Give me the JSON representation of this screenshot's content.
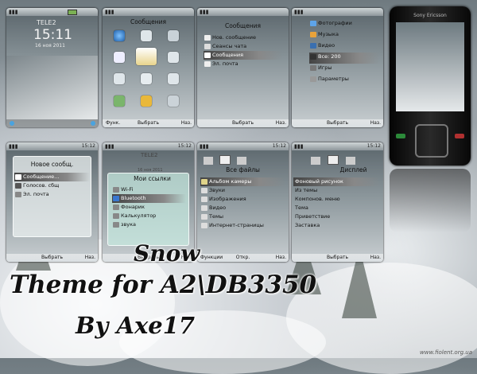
{
  "screen1": {
    "operator": "TELE2",
    "time": "15:11",
    "date": "16 ноя 2011",
    "softkeys": {
      "left": "",
      "center": "",
      "right": ""
    }
  },
  "screen2": {
    "title": "Сообщения",
    "softkeys": {
      "left": "Функ.",
      "center": "Выбрать",
      "right": "Наз."
    }
  },
  "screen3": {
    "title": "Сообщения",
    "items": [
      "Нов. сообщение",
      "Сеансы чата",
      "Сообщения",
      "Эл. почта"
    ],
    "selected": 2,
    "softkeys": {
      "left": "",
      "center": "Выбрать",
      "right": "Наз."
    }
  },
  "screen4": {
    "items": [
      "Фотографии",
      "Музыка",
      "Видео",
      "Все:  200",
      "Игры",
      "Параметры"
    ],
    "softkeys": {
      "left": "",
      "center": "Выбрать",
      "right": "Наз."
    }
  },
  "screen5": {
    "status_time": "15:12",
    "title": "Новое сообщ.",
    "items": [
      "Сообщение...",
      "Голосов. сбщ",
      "Эл. почта"
    ],
    "selected": 0,
    "softkeys": {
      "left": "",
      "center": "Выбрать",
      "right": "Наз."
    }
  },
  "screen6": {
    "status_time": "15:12",
    "operator": "TELE2",
    "date": "16 ноя 2011",
    "title": "Мои ссылки",
    "items": [
      "Wi-Fi",
      "Bluetooth",
      "Фонарик",
      "Калькулятор",
      "звука"
    ],
    "selected": 1,
    "softkeys": {
      "left": "",
      "center": "Выбрать",
      "right": "Наз."
    }
  },
  "screen7": {
    "status_time": "15:12",
    "title": "Все файлы",
    "items": [
      "Альбом камеры",
      "Звуки",
      "Изображения",
      "Видео",
      "Темы",
      "Интернет-страницы"
    ],
    "selected": 0,
    "softkeys": {
      "left": "Функции",
      "center": "Откр.",
      "right": "Наз."
    }
  },
  "screen8": {
    "status_time": "15:12",
    "title": "Дисплей",
    "items": [
      "Фоновый рисунок",
      "Из темы",
      "Компонов. меню",
      "Тема",
      "Приветствие",
      "Заставка"
    ],
    "selected": 0,
    "softkeys": {
      "left": "",
      "center": "Выбрать",
      "right": "Наз."
    }
  },
  "phone": {
    "brand": "Sony Ericsson"
  },
  "headline": {
    "line1": "Snow",
    "line2": "Theme for A2\\DB3350",
    "line3": "By Axe17"
  },
  "watermark": "www.fiolent.org.ua",
  "colors": {
    "selection": "#555555",
    "panel": "#e8eeee",
    "phone_body": "#141414"
  }
}
